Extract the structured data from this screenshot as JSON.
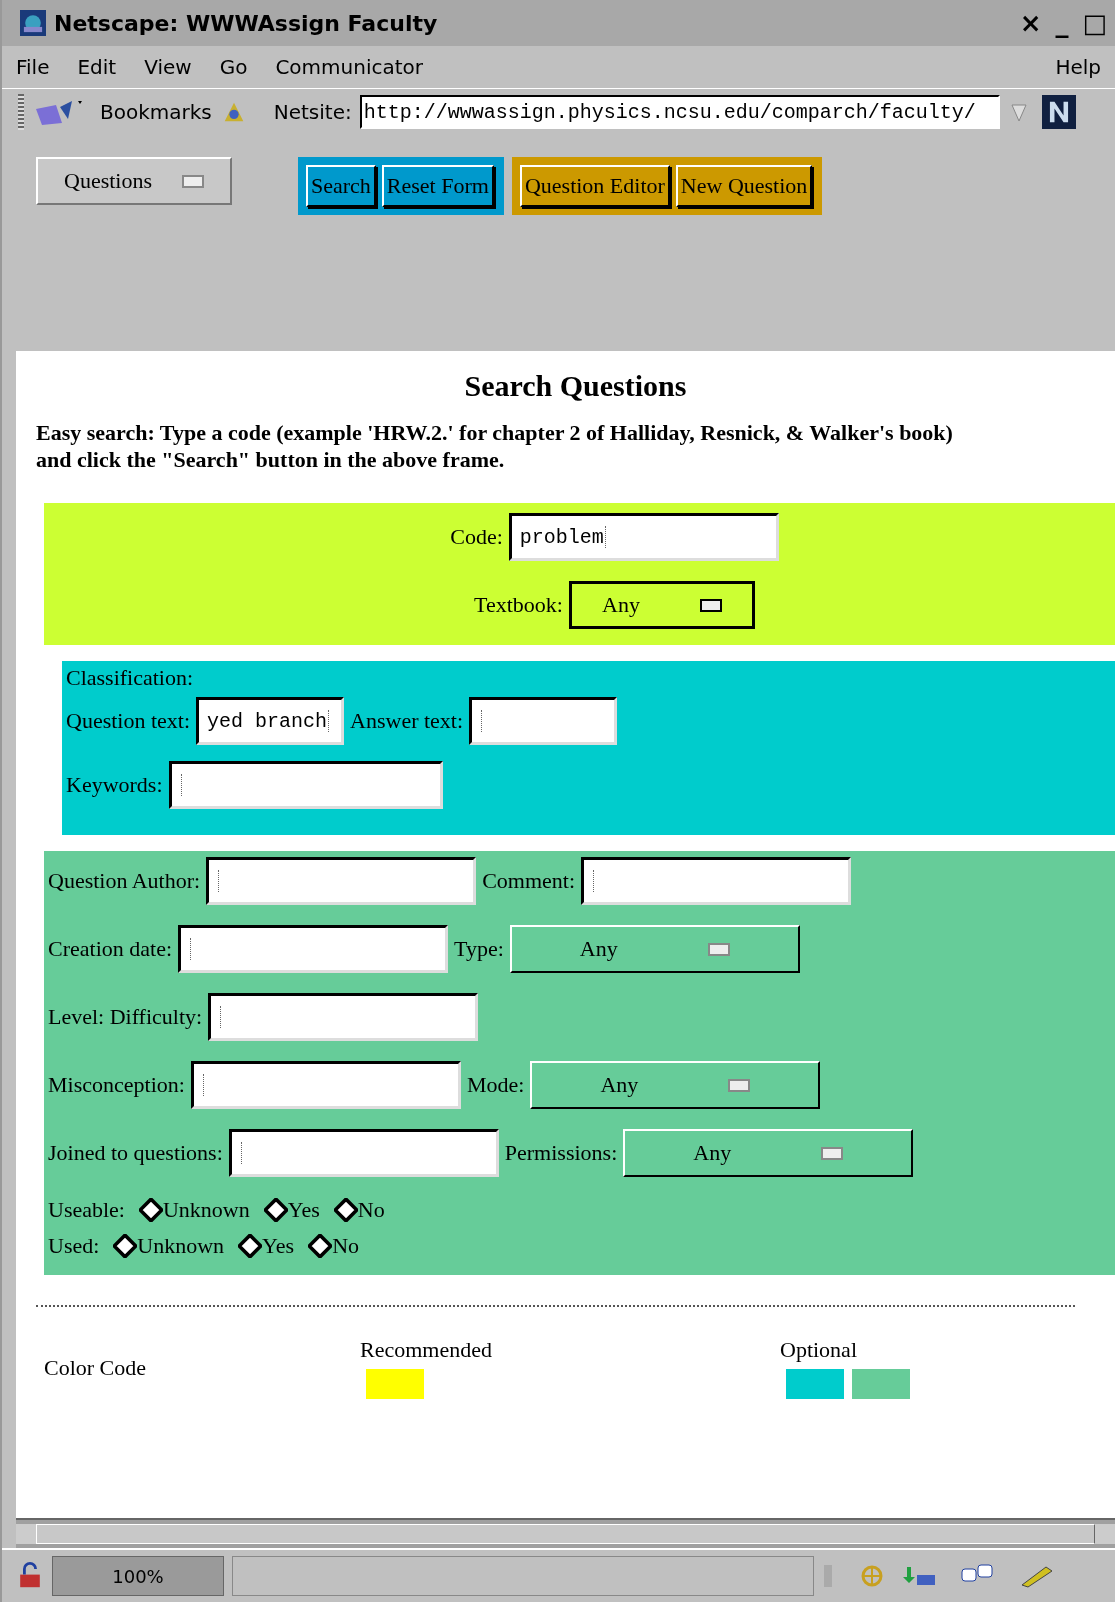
{
  "window": {
    "title": "Netscape: WWWAssign Faculty",
    "controls": [
      "×",
      "_",
      "□"
    ]
  },
  "menu": [
    "File",
    "Edit",
    "View",
    "Go",
    "Communicator"
  ],
  "menu_right": "Help",
  "toolbar": {
    "bookmarks": "Bookmarks",
    "location_label": "Netsite:",
    "url": "http://wwwassign.physics.ncsu.edu/comparch/faculty/"
  },
  "frame_nav": {
    "menu": "Questions",
    "groups": [
      {
        "color": "#0099cc",
        "buttons": [
          "Search",
          "Reset Form"
        ]
      },
      {
        "color": "#cc9900",
        "buttons": [
          "Question Editor",
          "New Question"
        ]
      }
    ]
  },
  "heading": "Search Questions",
  "intro": "Easy search: Type a code (example 'HRW.2.' for chapter 2 of Halliday, Resnick, & Walker's book) and click the \"Search\" button in the above frame.",
  "sections": [
    {
      "color": "#ccff33",
      "kind": "centered",
      "rows": [
        [
          {
            "kind": "text",
            "label": "Code:",
            "value": "problem"
          }
        ],
        [
          {
            "kind": "select",
            "label": "Textbook:",
            "value": "Any"
          }
        ]
      ]
    },
    {
      "color": "#00cccc",
      "kind": "plain",
      "title": "Classification:",
      "rows": [
        [
          {
            "kind": "text",
            "label": "Question text:",
            "value": "yed branch"
          },
          {
            "kind": "text",
            "label": "Answer text:"
          }
        ],
        [
          {
            "kind": "text",
            "label": "Keywords:"
          }
        ]
      ]
    },
    {
      "color": "#66cc99",
      "kind": "plain",
      "rows": [
        [
          {
            "kind": "text",
            "label": "Question Author:"
          },
          {
            "kind": "text",
            "label": "Comment:"
          }
        ],
        [
          {
            "kind": "text",
            "label": "Creation date:"
          },
          {
            "kind": "select",
            "label": "Type:",
            "value": "Any"
          }
        ],
        [
          {
            "kind": "text",
            "label": "Level: Difficulty:"
          }
        ],
        [
          {
            "kind": "text",
            "label": "Misconception:"
          },
          {
            "kind": "select",
            "label": "Mode:",
            "value": "Any"
          }
        ],
        [
          {
            "kind": "text",
            "label": "Joined to questions:"
          },
          {
            "kind": "select",
            "label": "Permissions:",
            "value": "Any"
          }
        ],
        [
          {
            "kind": "radio",
            "label": "Useable:",
            "options": [
              {
                "label": "Unknown",
                "selected": false
              },
              {
                "label": "Yes",
                "selected": false
              },
              {
                "label": "No",
                "selected": false
              }
            ]
          }
        ],
        [
          {
            "kind": "radio",
            "label": "Used:",
            "options": [
              {
                "label": "Unknown",
                "selected": false
              },
              {
                "label": "Yes",
                "selected": false
              },
              {
                "label": "No",
                "selected": false
              }
            ]
          }
        ]
      ]
    }
  ],
  "color_code": {
    "title": "Color Code",
    "groups": [
      {
        "label": "Recommended",
        "swatches": [
          {
            "color": "#ffff00"
          }
        ]
      },
      {
        "label": "Optional",
        "swatches": [
          {
            "color": "#00cccc"
          },
          {
            "color": "#66cc99"
          }
        ]
      }
    ]
  },
  "status_bar": {
    "zoom": "100%"
  }
}
